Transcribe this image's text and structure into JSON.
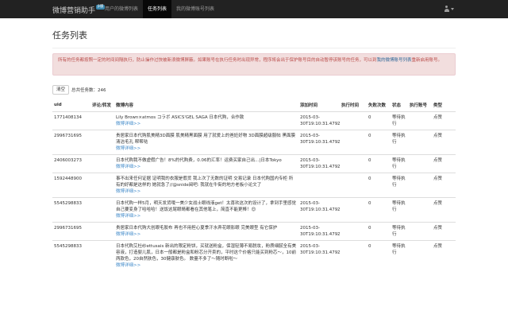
{
  "navbar": {
    "brand": "微博营销助手",
    "badge": "β版",
    "links": [
      "用户的微博列表",
      "任务列表",
      "我的微博账号列表"
    ],
    "active_index": 1
  },
  "page": {
    "title": "任务列表",
    "alert": {
      "text_before": "所有的任务都按照一定的时间间隔执行，防止操作过快被新浪微博屏蔽。如果账号在执行任务时出现异常，程序将会出于保护账号目的自动暂停该账号的任务，可以到",
      "link_text": "我的微博账号列表",
      "text_after": "重新启用账号。"
    },
    "clear_button": "清空",
    "total_label": "总共任务数：",
    "total_count": "246"
  },
  "table": {
    "columns": [
      "uid",
      "评论/转发",
      "微博内容",
      "添加时间",
      "执行时间",
      "失败次数",
      "状态",
      "执行账号",
      "类型"
    ],
    "detail_link": "微博详细>>",
    "rows": [
      {
        "uid": "1771408134",
        "comment": "",
        "content": "Lily Brown×atmos コラボ ASICS'GEL SAGA 日本代购，合作款",
        "added": "2015-03-30T19:10:31.479Z",
        "executed": "",
        "fails": "0",
        "status": "等待执行",
        "account": "",
        "type": "点赞"
      },
      {
        "uid": "2996731695",
        "comment": "",
        "content": "贵居家日本代购肌美精3D面膜 肌美精黑面膜 用了就爱上的爸妊好物 3D面膜超级服帖 黑面膜清洁毛孔 帮帮哒",
        "added": "2015-03-30T19:10:31.479Z",
        "executed": "",
        "fails": "0",
        "status": "等待执行",
        "account": "",
        "type": "点赞"
      },
      {
        "uid": "2406003273",
        "comment": "",
        "content": "日本代购我不做虚假广告！8%的代购费，0.06的汇率！运费买家自己出…|日本Tokyo",
        "added": "2015-03-30T19:10:31.479Z",
        "executed": "",
        "fails": "0",
        "status": "等待执行",
        "account": "",
        "type": "点赞"
      },
      {
        "uid": "1592448900",
        "comment": "",
        "content": "事不出来任何证据 证明我的衣服是假货 我上次了无数的证明 交易记录 日本代购国内专柜 所有的好都是这样的 她就急了//@snide阅吧: 我就在牛街的地方老板小论文了",
        "added": "",
        "executed": "",
        "fails": "0",
        "status": "等待执行",
        "account": "",
        "type": "点赞"
      },
      {
        "uid": "5545298833",
        "comment": "",
        "content": "日本代购一样5月，明天发货哦一美少女战士眼线液get！太喜欢这次的设计了，拿到手里感觉自己要变身了哈哈哈！送饭这尾眼睛都看在其他笔上，简直不能更棒！😊",
        "added": "2015-03-30T19:10:31.479Z",
        "executed": "",
        "fails": "0",
        "status": "等待执行",
        "account": "",
        "type": "点赞"
      },
      {
        "uid": "2996731695",
        "comment": "",
        "content": "贵居家日本代购大创眼毛胶布 再也不用担心夏季汗水弄花眼影眼 完美眼型 有它保护",
        "added": "2015-03-30T19:10:31.479Z",
        "executed": "",
        "fails": "0",
        "status": "等待执行",
        "account": "",
        "type": "点赞"
      },
      {
        "uid": "5545298833",
        "comment": "",
        "content": "日本代购艾杜纱ettusais 新出的限定粉饼，买就送粉盒，保湿轻薄不易脱妆，粉质细腻全有美容液，打造婴儿肌，日本一般都是粉盒和粉芯分开卖的，平时这个价格只能买到粉芯～，10前两款色，20自然肤色，30健康肤色。 数量不多了～随时断啦～",
        "added": "2015-03-30T19:10:31.479Z",
        "executed": "",
        "fails": "0",
        "status": "等待执行",
        "account": "",
        "type": "点赞"
      }
    ]
  }
}
